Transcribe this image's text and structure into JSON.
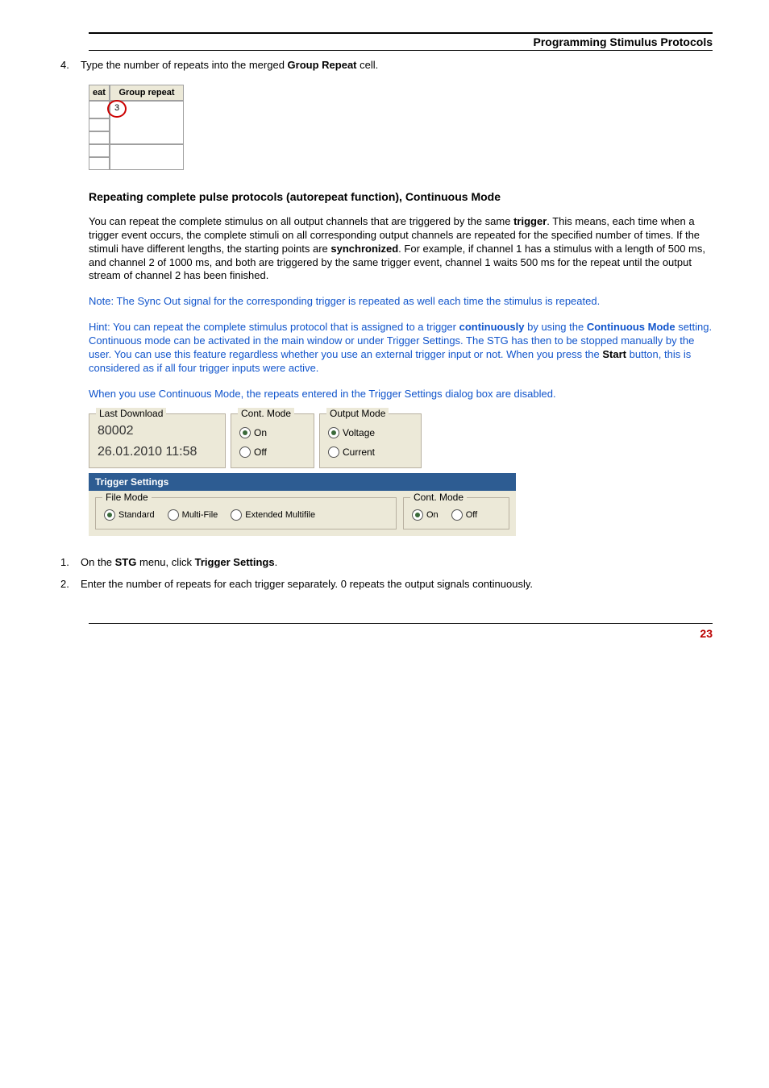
{
  "header": "Programming Stimulus Protocols",
  "step4": {
    "num": "4.",
    "text_before": "Type the number of repeats into the merged ",
    "bold": "Group Repeat",
    "text_after": " cell."
  },
  "group_repeat_table": {
    "head_left": "eat",
    "head_right": "Group repeat",
    "circled_value": "3"
  },
  "section_heading": "Repeating complete pulse protocols (autorepeat function), Continuous Mode",
  "para1": {
    "t1": "You can repeat the complete stimulus on all output channels that are triggered by the same ",
    "b1": "trigger",
    "t2": ". This means, each time when a trigger event occurs, the complete stimuli on all corresponding output channels are repeated for the specified number of times. If the stimuli have different lengths, the starting points are ",
    "b2": "synchronized",
    "t3": ". For example, if channel 1 has a stimulus with a length of 500 ms, and channel 2 of 1000 ms, and both are triggered by the same trigger event, channel 1 waits 500 ms for the repeat until the output stream of channel 2 has been finished."
  },
  "blue1": "Note: The Sync Out signal for the corresponding trigger is repeated as well each time the stimulus is repeated.",
  "blue2": {
    "t1": "Hint: You can repeat the complete stimulus protocol that is assigned to a trigger ",
    "b1": "continuously",
    "t2": " by using the ",
    "b2": "Continuous Mode",
    "t3": " setting. Continuous mode can be activated in the main window or under Trigger Settings.  The STG has then to be stopped manually by the user. You can use this feature regardless whether you use an external trigger input or not. When you press the ",
    "b3": "Start",
    "t4": " button, this is considered as if all four trigger inputs were active."
  },
  "blue3": "When you use Continuous Mode, the repeats entered in the Trigger Settings dialog box are disabled.",
  "download_panel": {
    "last_download": {
      "legend": "Last Download",
      "value": "80002",
      "date": "26.01.2010 11:58"
    },
    "cont_mode": {
      "legend": "Cont. Mode",
      "on": "On",
      "off": "Off"
    },
    "output_mode": {
      "legend": "Output Mode",
      "voltage": "Voltage",
      "current": "Current"
    }
  },
  "trigger_panel": {
    "title": "Trigger Settings",
    "file_mode": {
      "legend": "File Mode",
      "standard": "Standard",
      "multifile": "Multi-File",
      "extended": "Extended Multifile"
    },
    "cont_mode": {
      "legend": "Cont. Mode",
      "on": "On",
      "off": "Off"
    }
  },
  "step1": {
    "num": "1.",
    "t1": "On the ",
    "b1": "STG",
    "t2": " menu, click ",
    "b2": "Trigger Settings",
    "t3": "."
  },
  "step2": {
    "num": "2.",
    "text": "Enter the number of repeats for each trigger separately. 0 repeats the output signals continuously."
  },
  "page_number": "23"
}
